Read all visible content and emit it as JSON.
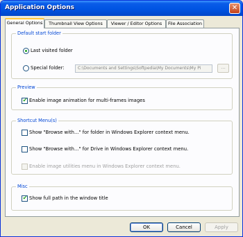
{
  "window": {
    "title": "Application Options",
    "close_glyph": "✕"
  },
  "tabs": [
    {
      "label": "General Options",
      "active": true
    },
    {
      "label": "Thumbnail View Options",
      "active": false
    },
    {
      "label": "Viewer / Editor Options",
      "active": false
    },
    {
      "label": "File Association",
      "active": false
    }
  ],
  "groups": {
    "start_folder": {
      "label": "Default start folder",
      "last_visited": {
        "label": "Last visited folder",
        "selected": true
      },
      "special": {
        "label": "Special folder:",
        "selected": false,
        "path": "C:\\Documents and Settings\\Softpedia\\My Documents\\My Pi",
        "browse_label": "..."
      }
    },
    "preview": {
      "label": "Preview",
      "animation": {
        "label": "Enable image animation for multi-frames images",
        "checked": true
      }
    },
    "shortcut": {
      "label": "Shortcut Menu(s)",
      "folder": {
        "label": "Show \"Browse with...\" for folder in Windows Explorer context menu.",
        "checked": false
      },
      "drive": {
        "label": "Show \"Browse with...\" for Drive in Windows Explorer context menu.",
        "checked": false
      },
      "utilities": {
        "label": "Enable image utilities menu in Windows Explorer context menu.",
        "checked": false,
        "disabled": true
      }
    },
    "misc": {
      "label": "Misc",
      "full_path": {
        "label": "Show full path in the window title",
        "checked": true
      }
    }
  },
  "buttons": {
    "ok": "OK",
    "cancel": "Cancel",
    "apply": "Apply"
  },
  "colors": {
    "title_blue": "#0054e3",
    "group_label": "#0046d5",
    "check_green": "#21a121"
  },
  "check_mark": "✔"
}
